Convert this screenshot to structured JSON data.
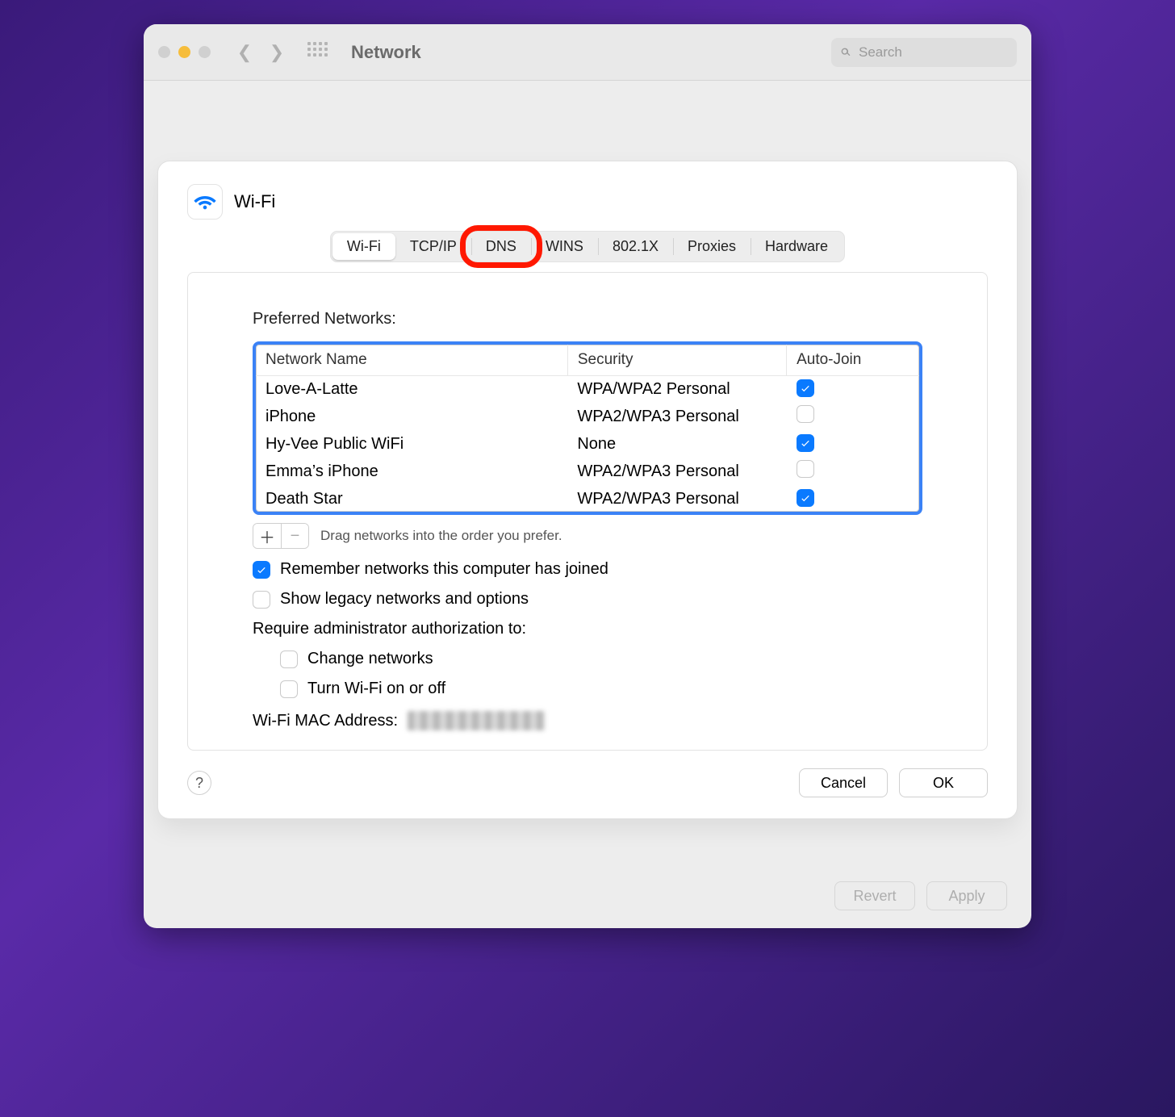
{
  "window": {
    "title": "Network",
    "search_placeholder": "Search",
    "footer": {
      "revert": "Revert",
      "apply": "Apply"
    }
  },
  "sheet": {
    "title": "Wi-Fi",
    "tabs": {
      "wifi": "Wi-Fi",
      "tcpip": "TCP/IP",
      "dns": "DNS",
      "wins": "WINS",
      "dot1x": "802.1X",
      "proxies": "Proxies",
      "hardware": "Hardware"
    },
    "active_tab": "wifi",
    "highlighted_tab": "dns"
  },
  "networks": {
    "section_title": "Preferred Networks:",
    "columns": {
      "name": "Network Name",
      "security": "Security",
      "auto_join": "Auto-Join"
    },
    "rows": [
      {
        "name": "Love-A-Latte",
        "security": "WPA/WPA2 Personal",
        "auto_join": true
      },
      {
        "name": "iPhone",
        "security": "WPA2/WPA3 Personal",
        "auto_join": false
      },
      {
        "name": "Hy-Vee Public WiFi",
        "security": "None",
        "auto_join": true
      },
      {
        "name": "Emma’s iPhone",
        "security": "WPA2/WPA3 Personal",
        "auto_join": false
      },
      {
        "name": "Death Star",
        "security": "WPA2/WPA3 Personal",
        "auto_join": true
      }
    ],
    "drag_hint": "Drag networks into the order you prefer."
  },
  "options": {
    "remember": {
      "label": "Remember networks this computer has joined",
      "checked": true
    },
    "legacy": {
      "label": "Show legacy networks and options",
      "checked": false
    },
    "require_admin_title": "Require administrator authorization to:",
    "change_networks": {
      "label": "Change networks",
      "checked": false
    },
    "turn_wifi": {
      "label": "Turn Wi-Fi on or off",
      "checked": false
    }
  },
  "mac": {
    "label": "Wi-Fi MAC Address:"
  },
  "footer": {
    "cancel": "Cancel",
    "ok": "OK"
  }
}
